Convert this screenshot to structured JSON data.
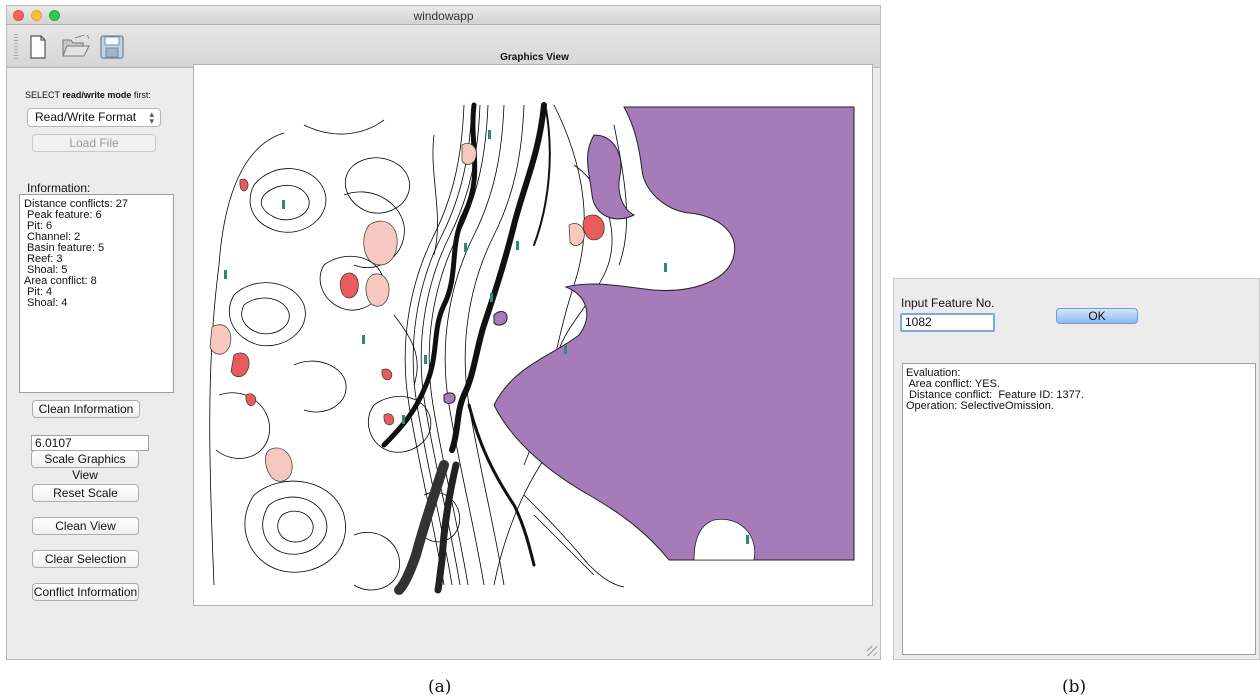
{
  "window": {
    "title": "windowapp"
  },
  "toolbar": {
    "icons": [
      "new-file-icon",
      "open-folder-icon",
      "save-icon"
    ]
  },
  "left_panel": {
    "mode_prefix": "SELECT ",
    "mode_bold": "read/write mode",
    "mode_suffix": " first:",
    "format_select": "Read/Write Format",
    "load_button": "Load File",
    "info_label": "Information:",
    "info_lines": [
      "Distance conflicts: 27",
      " Peak feature: 6",
      " Pit: 6",
      " Channel: 2",
      " Basin feature: 5",
      " Reef: 3",
      " Shoal: 5",
      "Area conflict: 8",
      " Pit: 4",
      " Shoal: 4"
    ],
    "clean_info_button": "Clean Information",
    "scale_value": "6.0107",
    "scale_button": "Scale Graphics View",
    "reset_scale_button": "Reset Scale",
    "clean_view_button": "Clean View",
    "clear_selection_button": "Clear Selection",
    "conflict_info_button": "Conflict Information"
  },
  "graphics_view": {
    "title": "Graphics View",
    "colors": {
      "water": "#a57bb9",
      "conflict_light": "#f6c8c0",
      "conflict_dark": "#e85c5c",
      "contour": "#000000"
    }
  },
  "dialog": {
    "label": "Input Feature No.",
    "input_value": "1082",
    "ok_button": "OK",
    "evaluation_lines": [
      "Evaluation:",
      " Area conflict: YES.",
      " Distance conflict:  Feature ID: 1377.",
      "Operation: SelectiveOmission."
    ]
  },
  "captions": {
    "a": "(a)",
    "b": "(b)"
  }
}
